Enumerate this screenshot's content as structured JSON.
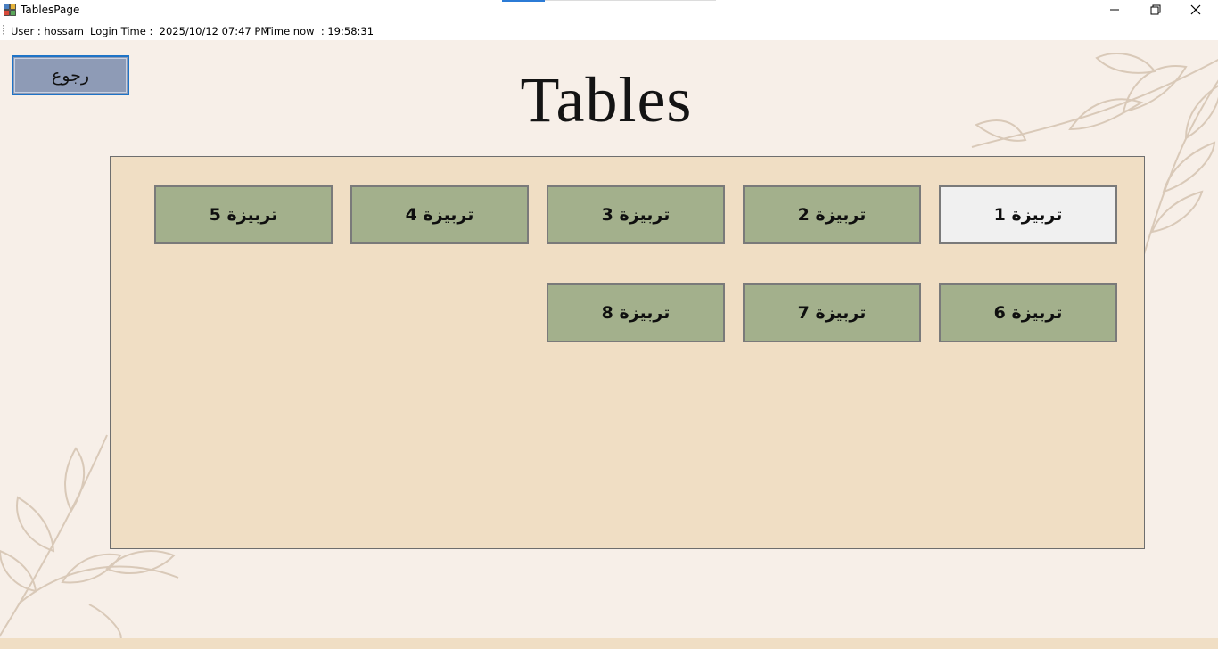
{
  "window": {
    "title": "TablesPage",
    "icon": "app-window-icon",
    "controls": [
      "minimize-icon",
      "restore-icon",
      "close-icon"
    ]
  },
  "status": {
    "user": "User : hossam",
    "login_time": "Login Time :  2025/10/12 07:47 PM",
    "time_now": "Time now  : 19:58:31"
  },
  "back_button": {
    "label": "رجوع"
  },
  "page": {
    "title": "Tables"
  },
  "tables": [
    {
      "label": "تربيزة 1",
      "selected": true
    },
    {
      "label": "تربيزة 2",
      "selected": false
    },
    {
      "label": "تربيزة 3",
      "selected": false
    },
    {
      "label": "تربيزة 4",
      "selected": false
    },
    {
      "label": "تربيزة 5",
      "selected": false
    },
    {
      "label": "تربيزة 6",
      "selected": false
    },
    {
      "label": "تربيزة 7",
      "selected": false
    },
    {
      "label": "تربيزة 8",
      "selected": false
    }
  ],
  "colors": {
    "background": "#f7efe8",
    "panel": "#f0dec4",
    "table_button": "#a3b08c",
    "table_button_selected": "#f0f0f0",
    "back_button": "#8e9bb6",
    "focus_border": "#1f74c7"
  }
}
